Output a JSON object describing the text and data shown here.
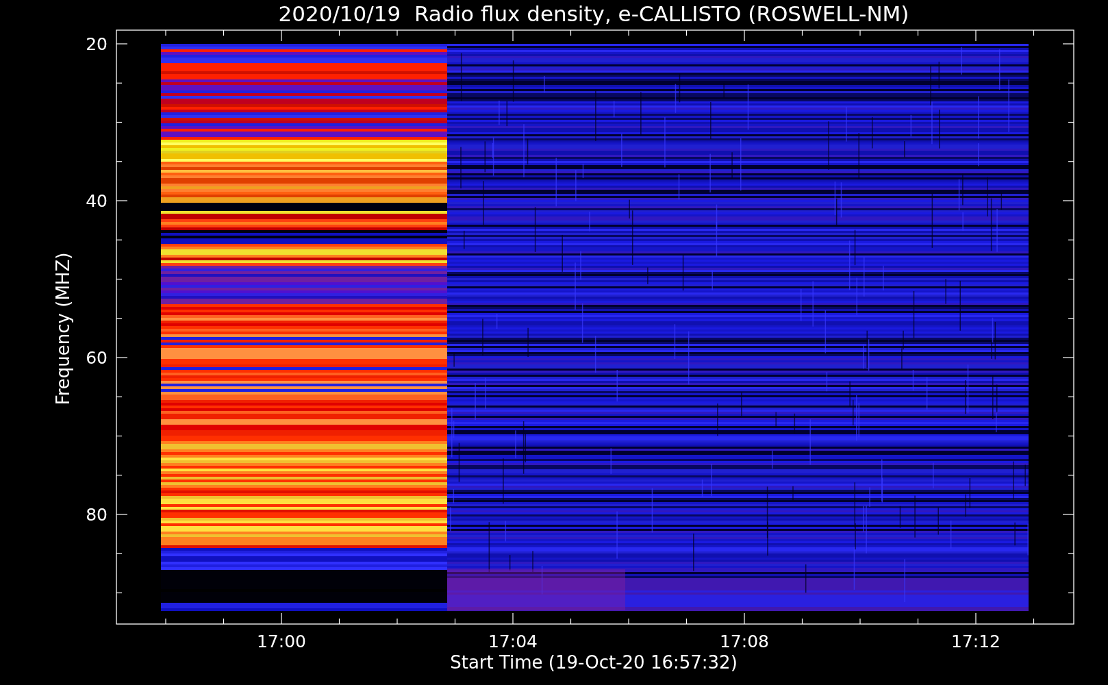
{
  "plot": {
    "title": "2020/10/19  Radio flux density, e-CALLISTO (ROSWELL-NM)",
    "y_axis_label": "Frequency (MHZ)",
    "x_axis_label": "Start Time (19-Oct-20 16:57:32)",
    "y_tick_labels": [
      "20",
      "40",
      "60",
      "80"
    ],
    "x_tick_labels": [
      "17:00",
      "17:04",
      "17:08",
      "17:12"
    ]
  }
}
